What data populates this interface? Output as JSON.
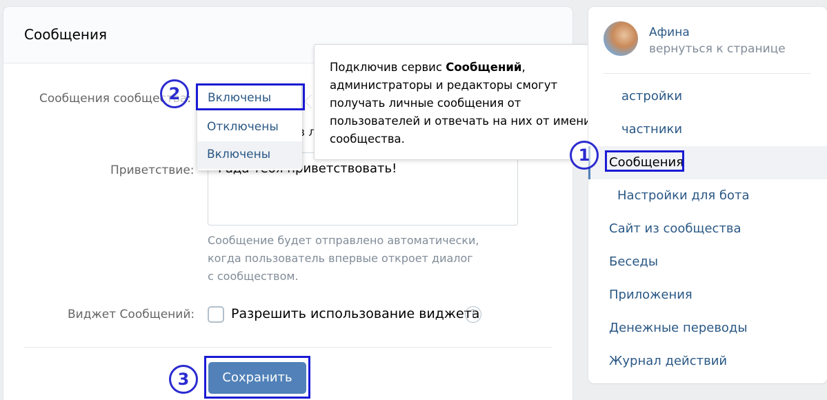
{
  "main": {
    "title": "Сообщения",
    "community_messages_label": "Сообщения сообщества:",
    "dropdown": {
      "selected": "Включены",
      "options": [
        "Отключены",
        "Включены"
      ]
    },
    "partial_text_behind_tooltip": "в л",
    "greeting_label": "Приветствие:",
    "greeting_value": "Рада тебя приветствовать!",
    "hint_lines": [
      "Сообщение будет отправлено автоматически,",
      "когда пользователь впервые откроет диалог",
      "с сообществом."
    ],
    "widget_label": "Виджет Сообщений:",
    "widget_checkbox_label": "Разрешить использование виджета",
    "help_glyph": "?",
    "save_label": "Сохранить"
  },
  "tooltip": {
    "prefix": "Подключив сервис ",
    "bold": "Сообщений",
    "suffix": ", администраторы и редакторы смогут получать личные сообщения от пользователей и отвечать на них от имени сообщества."
  },
  "sidebar": {
    "profile_name": "Афина",
    "profile_link": "вернуться к странице",
    "items": [
      {
        "label": "Настройки",
        "visible": "астройки"
      },
      {
        "label": "Участники",
        "visible": "частники"
      },
      {
        "label": "Сообщения",
        "visible": "Сообщения"
      },
      {
        "label": "Настройки для бота",
        "visible": "Настройки для бота"
      },
      {
        "label": "Сайт из сообщества",
        "visible": "Сайт из сообщества"
      },
      {
        "label": "Беседы",
        "visible": "Беседы"
      },
      {
        "label": "Приложения",
        "visible": "Приложения"
      },
      {
        "label": "Денежные переводы",
        "visible": "Денежные переводы"
      },
      {
        "label": "Журнал действий",
        "visible": "Журнал действий"
      }
    ]
  },
  "annotations": [
    "1",
    "2",
    "3"
  ],
  "colors": {
    "accent": "#5181b8",
    "link": "#2a5885",
    "annotation": "#1a1ad4",
    "background": "#edeef0"
  }
}
